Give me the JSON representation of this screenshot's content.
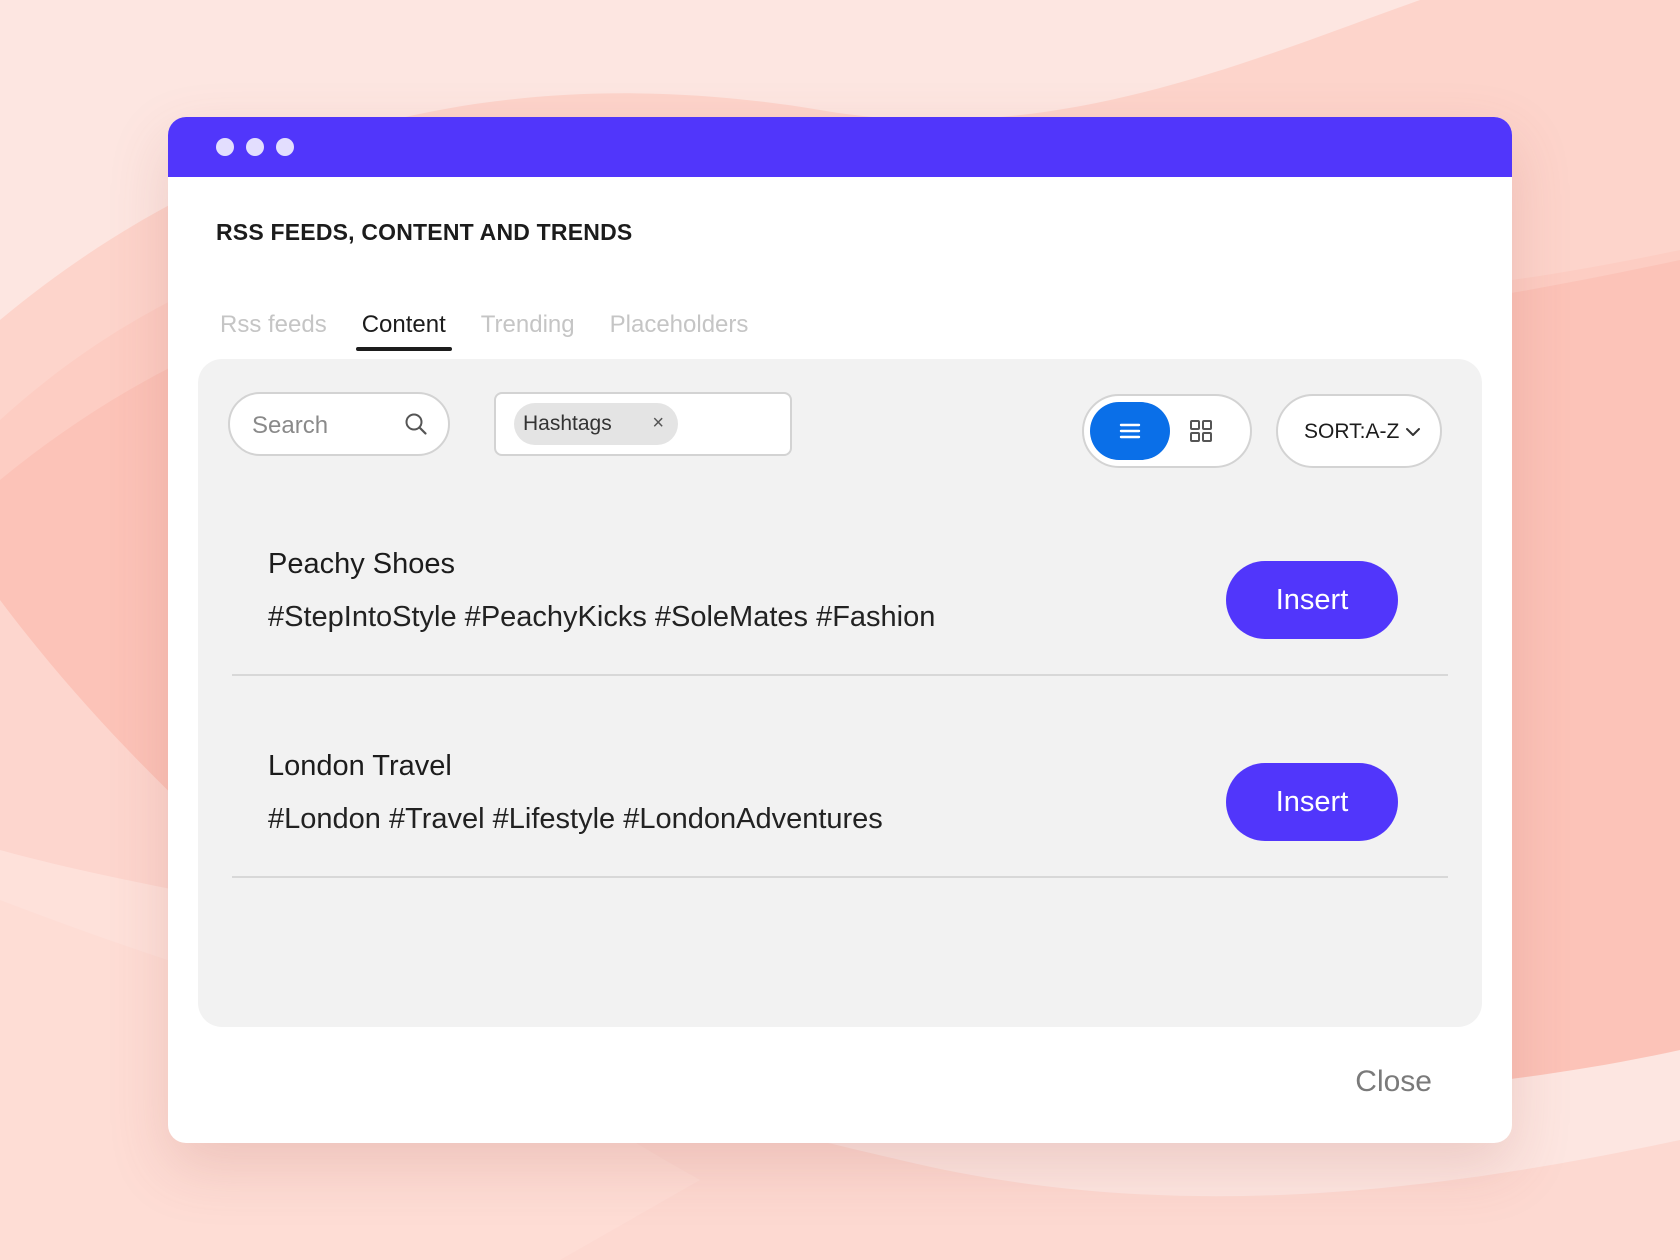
{
  "window": {
    "heading": "RSS FEEDS, CONTENT AND TRENDS",
    "close_label": "Close"
  },
  "tabs": [
    {
      "label": "Rss feeds",
      "active": false
    },
    {
      "label": "Content",
      "active": true
    },
    {
      "label": "Trending",
      "active": false
    },
    {
      "label": "Placeholders",
      "active": false
    }
  ],
  "toolbar": {
    "search_placeholder": "Search",
    "filter_chip": "Hashtags",
    "filter_chip_remove": "×",
    "view_modes": [
      "list",
      "grid"
    ],
    "active_view": "list",
    "sort_label": "SORT:A-Z"
  },
  "items": [
    {
      "title": "Peachy Shoes",
      "tags": "#StepIntoStyle #PeachyKicks #SoleMates #Fashion",
      "action": "Insert"
    },
    {
      "title": "London Travel",
      "tags": "#London #Travel #Lifestyle #LondonAdventures",
      "action": "Insert"
    }
  ],
  "colors": {
    "accent": "#5136fb",
    "toggle_active": "#0a6fe8",
    "background": "#fde6e1",
    "panel": "#f2f2f2"
  },
  "icons": {
    "search": "search-icon",
    "list_view": "list-icon",
    "grid_view": "grid-icon",
    "sort_chevron": "chevron-down-icon",
    "chip_remove": "close-icon"
  }
}
